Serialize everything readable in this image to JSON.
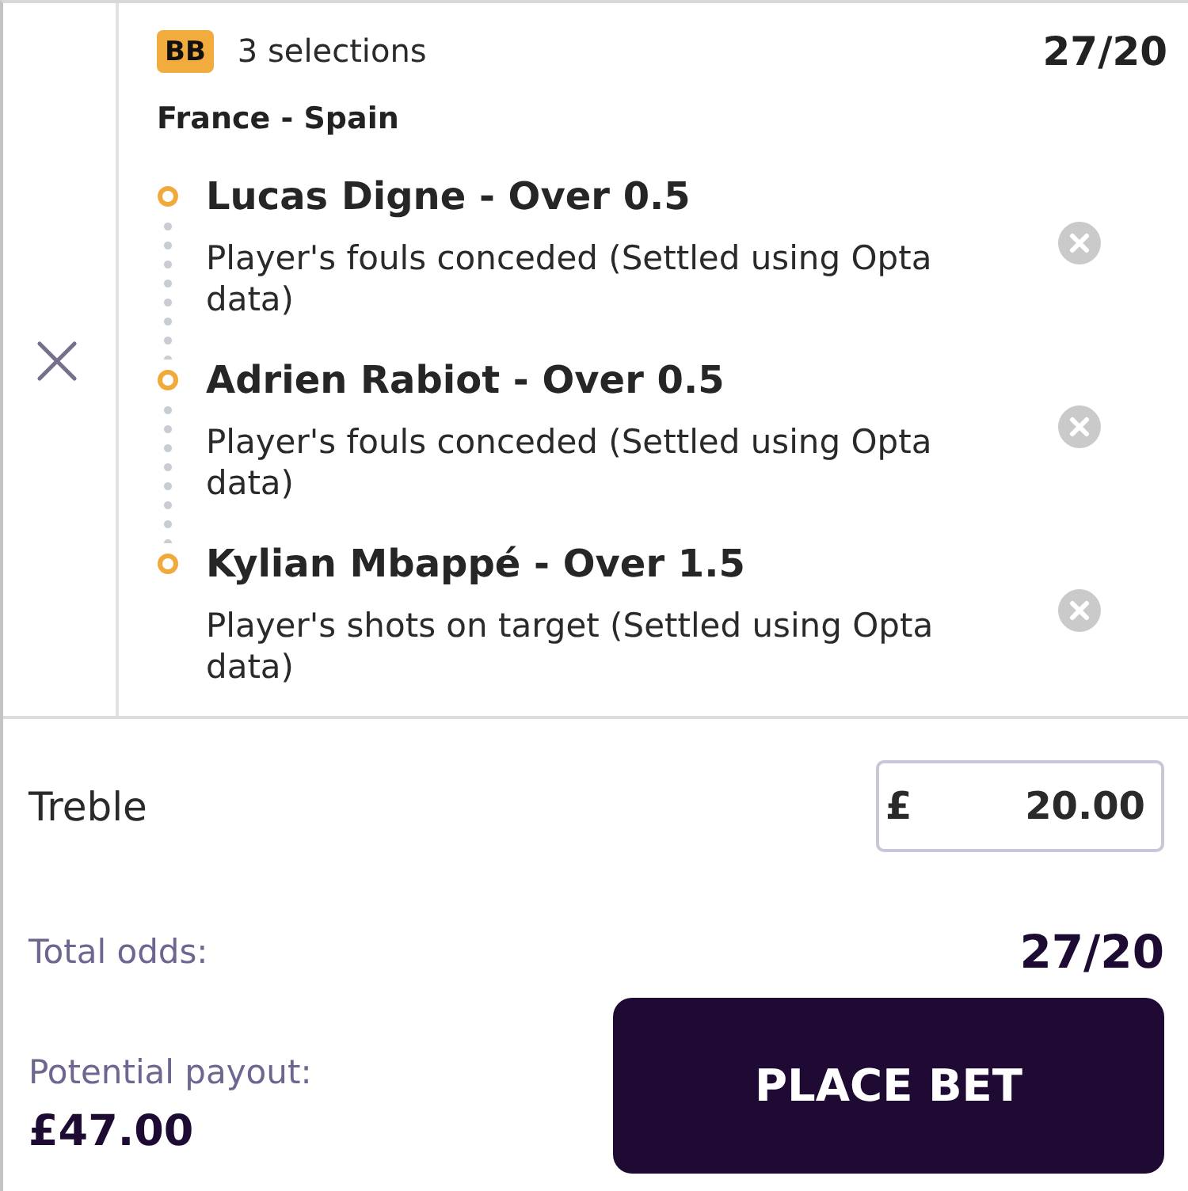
{
  "header": {
    "badge": "BB",
    "selection_count": "3 selections",
    "odds": "27/20"
  },
  "event": "France - Spain",
  "selections": [
    {
      "title": "Lucas Digne - Over 0.5",
      "market": "Player's fouls conceded (Settled using Opta data)"
    },
    {
      "title": "Adrien Rabiot - Over 0.5",
      "market": "Player's fouls conceded (Settled using Opta data)"
    },
    {
      "title": "Kylian Mbappé - Over 1.5",
      "market": "Player's shots on target (Settled using Opta data)"
    }
  ],
  "bet": {
    "type": "Treble",
    "stake": {
      "currency": "£",
      "value": "20.00"
    }
  },
  "summary": {
    "total_odds_label": "Total odds:",
    "total_odds": "27/20",
    "payout_label": "Potential payout:",
    "payout": "£47.00"
  },
  "place_bet_button": {
    "label": "PLACE BET"
  }
}
